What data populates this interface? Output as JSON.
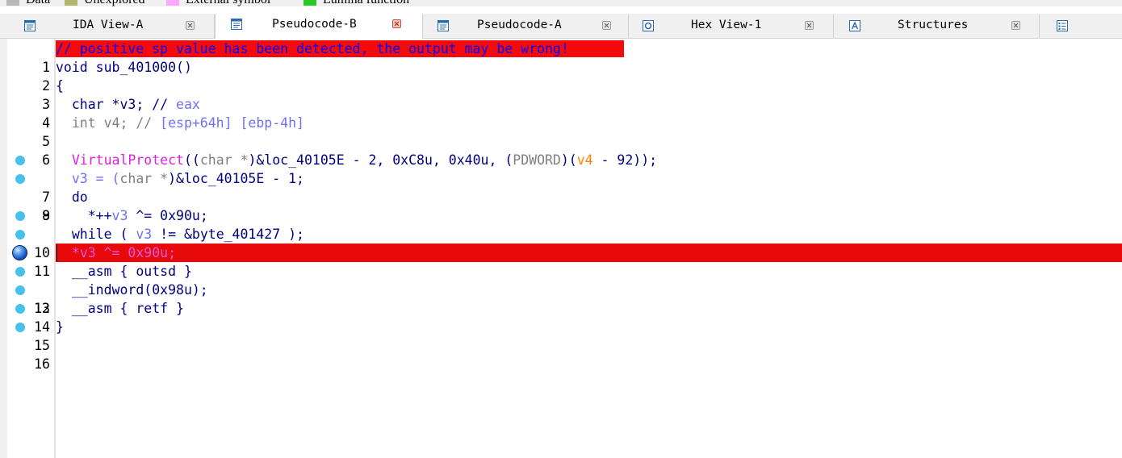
{
  "legend": [
    {
      "label": "Data",
      "color": "#b8b8b8"
    },
    {
      "label": "Unexplored",
      "color": "#b4b46e"
    },
    {
      "label": "External symbol",
      "color": "#ffa8ff"
    },
    {
      "label": "Lumina function",
      "color": "#28c828"
    }
  ],
  "tabs": [
    {
      "label": "IDA View-A",
      "icon": "ida-view-icon",
      "active": false
    },
    {
      "label": "Pseudocode-B",
      "icon": "pseudocode-icon",
      "active": true
    },
    {
      "label": "Pseudocode-A",
      "icon": "pseudocode-icon",
      "active": false
    },
    {
      "label": "Hex View-1",
      "icon": "hex-view-icon",
      "active": false
    },
    {
      "label": "Structures",
      "icon": "structures-icon",
      "active": false
    },
    {
      "label": "",
      "icon": "enums-icon",
      "active": false
    }
  ],
  "colors": {
    "highlight": "#e80a0a",
    "breakpoint": "#46c0ec",
    "keyword": "#000080",
    "comment": "#808080",
    "function": "#e020e0",
    "variable": "#ff8000",
    "register": "#7070f0"
  },
  "code": {
    "warning": "// positive sp value has been detected, the output may be wrong!",
    "lines": [
      {
        "num": "1",
        "breakpoint": "none"
      },
      {
        "num": "2",
        "breakpoint": "none",
        "text": "void sub_401000()"
      },
      {
        "num": "3",
        "breakpoint": "none",
        "text": "{"
      },
      {
        "num": "4",
        "breakpoint": "none",
        "a": "  char *v3; // ",
        "b": "eax"
      },
      {
        "num": "5",
        "breakpoint": "none",
        "a": "  int v4; // ",
        "b": "[esp+64h] [ebp-4h]"
      },
      {
        "num": "6",
        "breakpoint": "none",
        "text": ""
      },
      {
        "num": "7",
        "breakpoint": "small",
        "f": "VirtualProtect",
        "p1": "((",
        "c1": "char *",
        "p2": ")&loc_40105E - 2, 0xC8u, 0x40u, (",
        "c2": "PDWORD",
        "p3": ")(",
        "v": "v4",
        "p4": " - 92));"
      },
      {
        "num": "8",
        "breakpoint": "small",
        "a": "  v3 = (",
        "c": "char *",
        "d": ")&loc_40105E - 1;"
      },
      {
        "num": "9",
        "breakpoint": "none",
        "text": "  do"
      },
      {
        "num": "10",
        "breakpoint": "small",
        "a": "    *++",
        "b": "v3",
        "d": " ^= 0x90u;"
      },
      {
        "num": "11",
        "breakpoint": "small",
        "a": "  while ( ",
        "b": "v3",
        "d": " != &byte_401427 );"
      },
      {
        "num": "12",
        "breakpoint": "active",
        "a": "  *",
        "b": "v3",
        "d": " ^= 0x90u;"
      },
      {
        "num": "13",
        "breakpoint": "small",
        "text": "  __asm { outsd }"
      },
      {
        "num": "14",
        "breakpoint": "small",
        "text": "  __indword(0x98u);"
      },
      {
        "num": "15",
        "breakpoint": "small",
        "text": "  __asm { retf }"
      },
      {
        "num": "16",
        "breakpoint": "small",
        "text": "}"
      }
    ]
  }
}
